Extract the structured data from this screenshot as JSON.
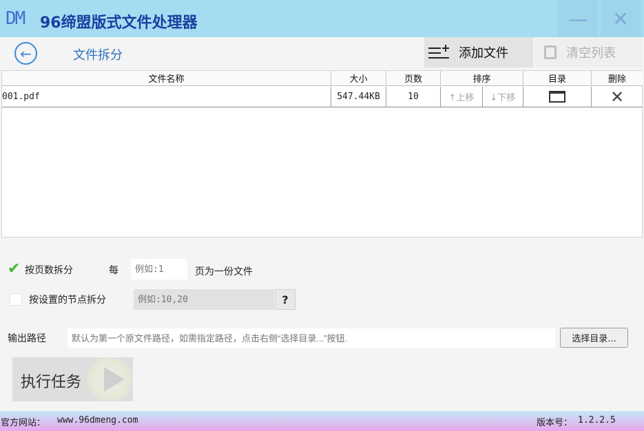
{
  "app": {
    "logo": "DM",
    "title": "96缔盟版式文件处理器"
  },
  "window": {
    "minimize": "—",
    "close": "✕"
  },
  "toolbar": {
    "back_icon": "arrow-left-icon",
    "page_title": "文件拆分",
    "add_file": "添加文件",
    "clear_list": "清空列表"
  },
  "table": {
    "headers": {
      "name": "文件名称",
      "size": "大小",
      "pages": "页数",
      "sort": "排序",
      "dir": "目录",
      "delete": "删除"
    },
    "rows": [
      {
        "name": "001.pdf",
        "size": "547.44KB",
        "pages": "10",
        "up": "↑上移",
        "down": "↓下移",
        "delete": "✕"
      }
    ]
  },
  "split_by_pages": {
    "checked": true,
    "label": "按页数拆分",
    "per": "每",
    "placeholder": "例如:1",
    "suffix": "页为一份文件"
  },
  "split_by_nodes": {
    "checked": false,
    "label": "按设置的节点拆分",
    "placeholder": "例如:10,20",
    "help": "?"
  },
  "output": {
    "label": "输出路径",
    "placeholder": "默认为第一个原文件路径，如需指定路径，点击右侧“选择目录...”按钮.",
    "browse": "选择目录..."
  },
  "run": {
    "label": "执行任务"
  },
  "status": {
    "site_label": "官方网站：",
    "site_url": "www.96dmeng.com",
    "version_label": "版本号：",
    "version": "1.2.2.5"
  },
  "colors": {
    "title_bar": "#a6dcf2",
    "accent": "#2a72c0",
    "check": "#3cb832"
  }
}
